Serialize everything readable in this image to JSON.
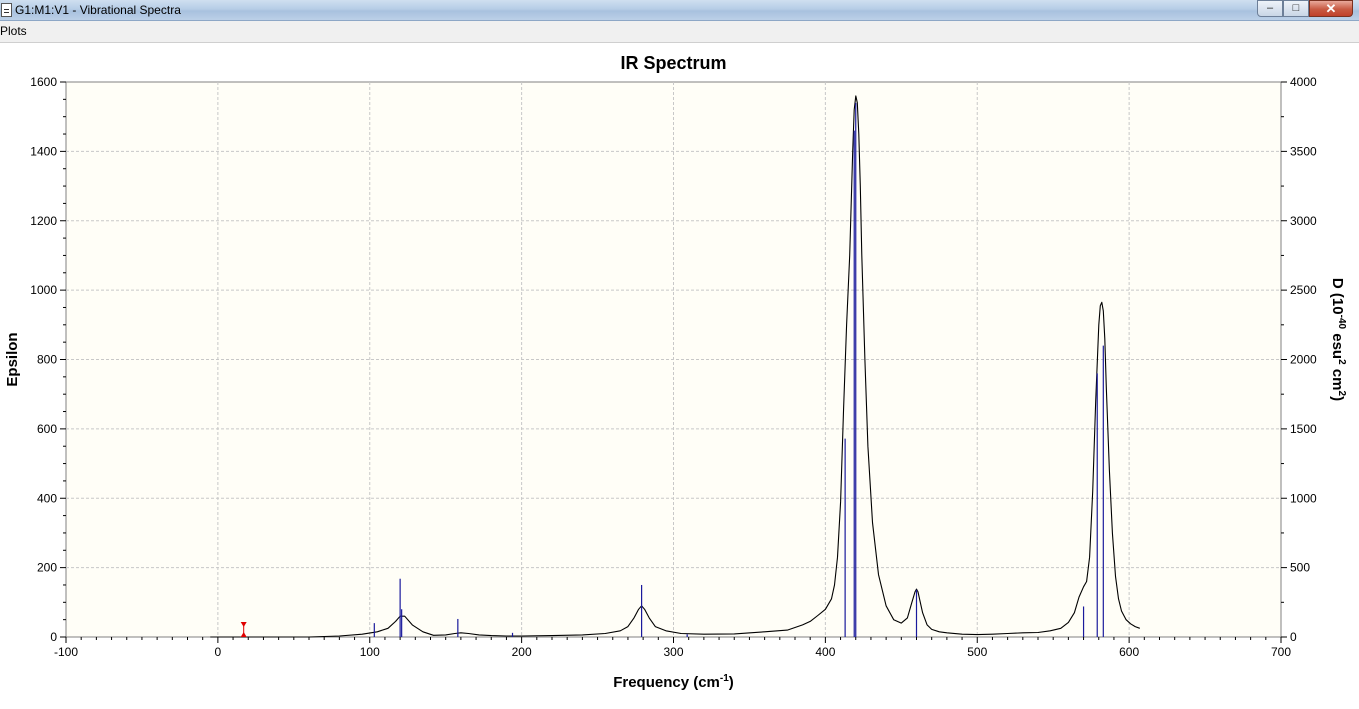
{
  "window": {
    "title": "G1:M1:V1 - Vibrational Spectra",
    "icon": "document-icon",
    "controls": [
      "minimize-icon",
      "maximize-icon",
      "close-icon"
    ]
  },
  "menu": {
    "items": [
      "Plots"
    ]
  },
  "colors": {
    "plot_background": "#fffef7",
    "grid": "#c8c8c8",
    "spectrum_line": "#000000",
    "stick": "#1a1a9c",
    "marker": "#e00000"
  },
  "chart_data": {
    "type": "line",
    "title": "IR Spectrum",
    "xlabel": "Frequency (cm",
    "xlabel_sup": "-1",
    "xlabel_close": ")",
    "ylabel": "Epsilon",
    "y2label_parts": [
      "D (10",
      "-40",
      " esu",
      "2",
      " cm",
      "2",
      ")"
    ],
    "xlim": [
      -100,
      700
    ],
    "ylim": [
      0,
      1600
    ],
    "y2lim": [
      0,
      4000
    ],
    "xticks": [
      -100,
      0,
      100,
      200,
      300,
      400,
      500,
      600,
      700
    ],
    "yticks": [
      0,
      200,
      400,
      600,
      800,
      1000,
      1200,
      1400,
      1600
    ],
    "y2ticks": [
      0,
      500,
      1000,
      1500,
      2000,
      2500,
      3000,
      3500,
      4000
    ],
    "grid": true,
    "marker_x": 17,
    "series": [
      {
        "kind": "spectrum",
        "axis": "left",
        "x": [
          -5,
          20,
          60,
          80,
          95,
          105,
          112,
          117,
          120,
          123,
          128,
          135,
          142,
          150,
          156,
          160,
          165,
          172,
          180,
          190,
          200,
          220,
          240,
          255,
          265,
          270,
          274,
          277,
          279,
          281,
          284,
          288,
          295,
          305,
          320,
          340,
          360,
          375,
          385,
          390,
          395,
          400,
          404,
          406,
          408,
          410,
          412,
          414,
          416,
          417,
          418,
          419,
          420,
          421,
          422,
          423,
          424,
          426,
          428,
          431,
          435,
          440,
          445,
          450,
          454,
          457,
          459,
          460,
          461,
          462,
          464,
          467,
          470,
          475,
          480,
          490,
          500,
          510,
          520,
          530,
          540,
          548,
          555,
          560,
          564,
          567,
          570,
          572,
          574,
          576,
          578,
          580,
          581,
          582,
          583,
          584,
          585,
          587,
          589,
          591,
          593,
          595,
          598,
          601,
          604,
          607
        ],
        "y": [
          0,
          0,
          0,
          3,
          8,
          15,
          25,
          45,
          60,
          60,
          35,
          15,
          5,
          6,
          10,
          12,
          10,
          6,
          4,
          3,
          3,
          4,
          6,
          10,
          18,
          30,
          55,
          80,
          90,
          80,
          55,
          30,
          18,
          10,
          8,
          9,
          15,
          20,
          35,
          45,
          62,
          80,
          110,
          150,
          230,
          390,
          660,
          900,
          1100,
          1250,
          1400,
          1520,
          1560,
          1540,
          1450,
          1300,
          1100,
          800,
          550,
          330,
          180,
          90,
          50,
          40,
          55,
          100,
          130,
          138,
          130,
          110,
          70,
          35,
          22,
          15,
          12,
          8,
          7,
          8,
          10,
          12,
          13,
          18,
          25,
          42,
          70,
          115,
          145,
          160,
          230,
          420,
          680,
          900,
          955,
          965,
          940,
          860,
          720,
          480,
          300,
          175,
          110,
          75,
          50,
          38,
          30,
          25
        ]
      },
      {
        "kind": "sticks",
        "axis": "right",
        "x": [
          103,
          120,
          121,
          158,
          194,
          279,
          309,
          413,
          419,
          420,
          460,
          570,
          579,
          583
        ],
        "y": [
          100,
          420,
          200,
          130,
          30,
          375,
          20,
          1430,
          3650,
          3850,
          340,
          220,
          1900,
          2100
        ]
      }
    ]
  }
}
